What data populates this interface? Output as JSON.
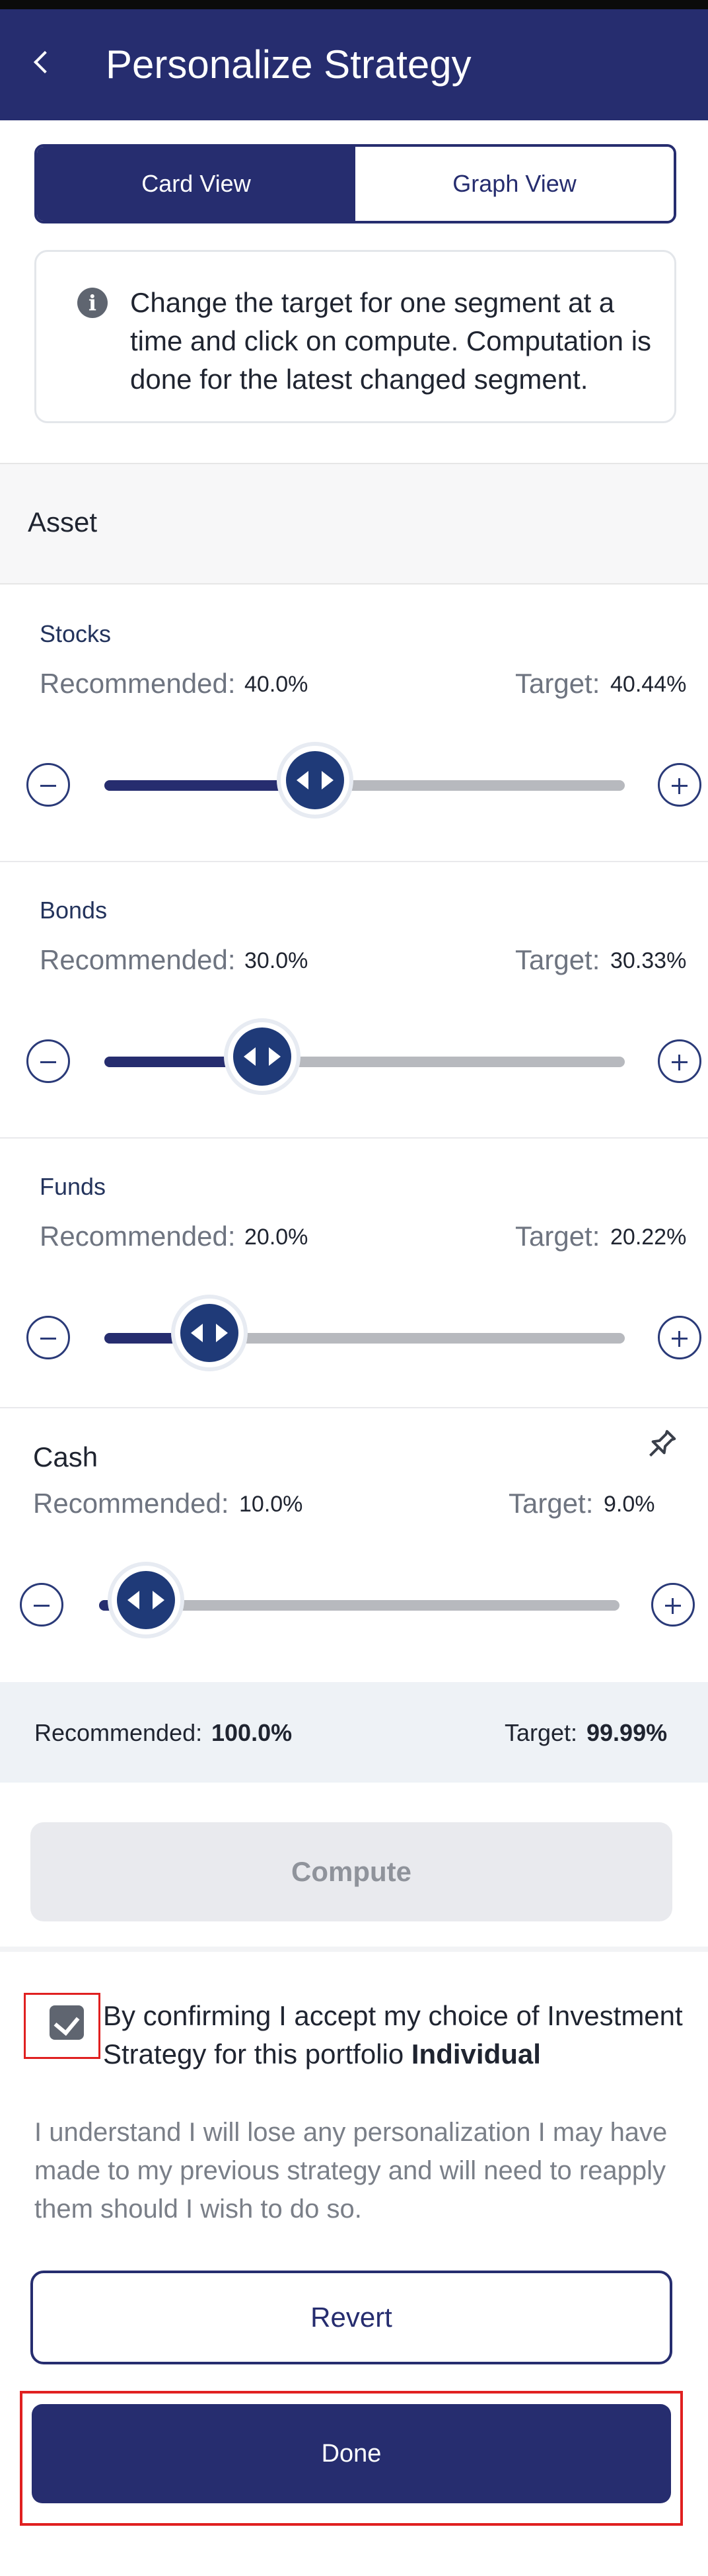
{
  "app": {
    "title": "Personalize Strategy"
  },
  "view_toggle": {
    "card_label": "Card View",
    "graph_label": "Graph View",
    "selected": "Card View"
  },
  "info": {
    "text": "Change the target for one segment at a time and click on compute. Computation is done for the latest changed segment."
  },
  "asset_header": "Asset",
  "assets": [
    {
      "name": "Stocks",
      "recommended_label": "Recommended:",
      "recommended_value": "40.0%",
      "target_label": "Target:",
      "target_value": "40.44%",
      "target_fraction": 0.4044
    },
    {
      "name": "Bonds",
      "recommended_label": "Recommended:",
      "recommended_value": "30.0%",
      "target_label": "Target:",
      "target_value": "30.33%",
      "target_fraction": 0.3033
    },
    {
      "name": "Funds",
      "recommended_label": "Recommended:",
      "recommended_value": "20.0%",
      "target_label": "Target:",
      "target_value": "20.22%",
      "target_fraction": 0.2022
    },
    {
      "name": "Cash",
      "recommended_label": "Recommended:",
      "recommended_value": "10.0%",
      "target_label": "Target:",
      "target_value": "9.0%",
      "target_fraction": 0.09,
      "pinned": true
    }
  ],
  "totals": {
    "recommended_label": "Recommended:",
    "recommended_value": "100.0%",
    "target_label": "Target:",
    "target_value": "99.99%"
  },
  "compute_label": "Compute",
  "confirmation": {
    "checked": true,
    "text": "By confirming I accept my choice of Investment Strategy for this portfolio",
    "portfolio": "Individual"
  },
  "disclaimer": "I understand I will lose any personalization I may have made to my previous strategy and will need to reapply them should I wish to do so.",
  "revert_label": "Revert",
  "done_label": "Done",
  "colors": {
    "primary": "#262d6f",
    "thumb": "#1f3a78",
    "highlight": "#e02020"
  },
  "icons": {
    "back": "chevron-left-icon",
    "info": "info-icon",
    "pin": "pin-icon",
    "minus": "minus-circle-icon",
    "plus": "plus-circle-icon",
    "check": "checkbox-checked-icon"
  }
}
